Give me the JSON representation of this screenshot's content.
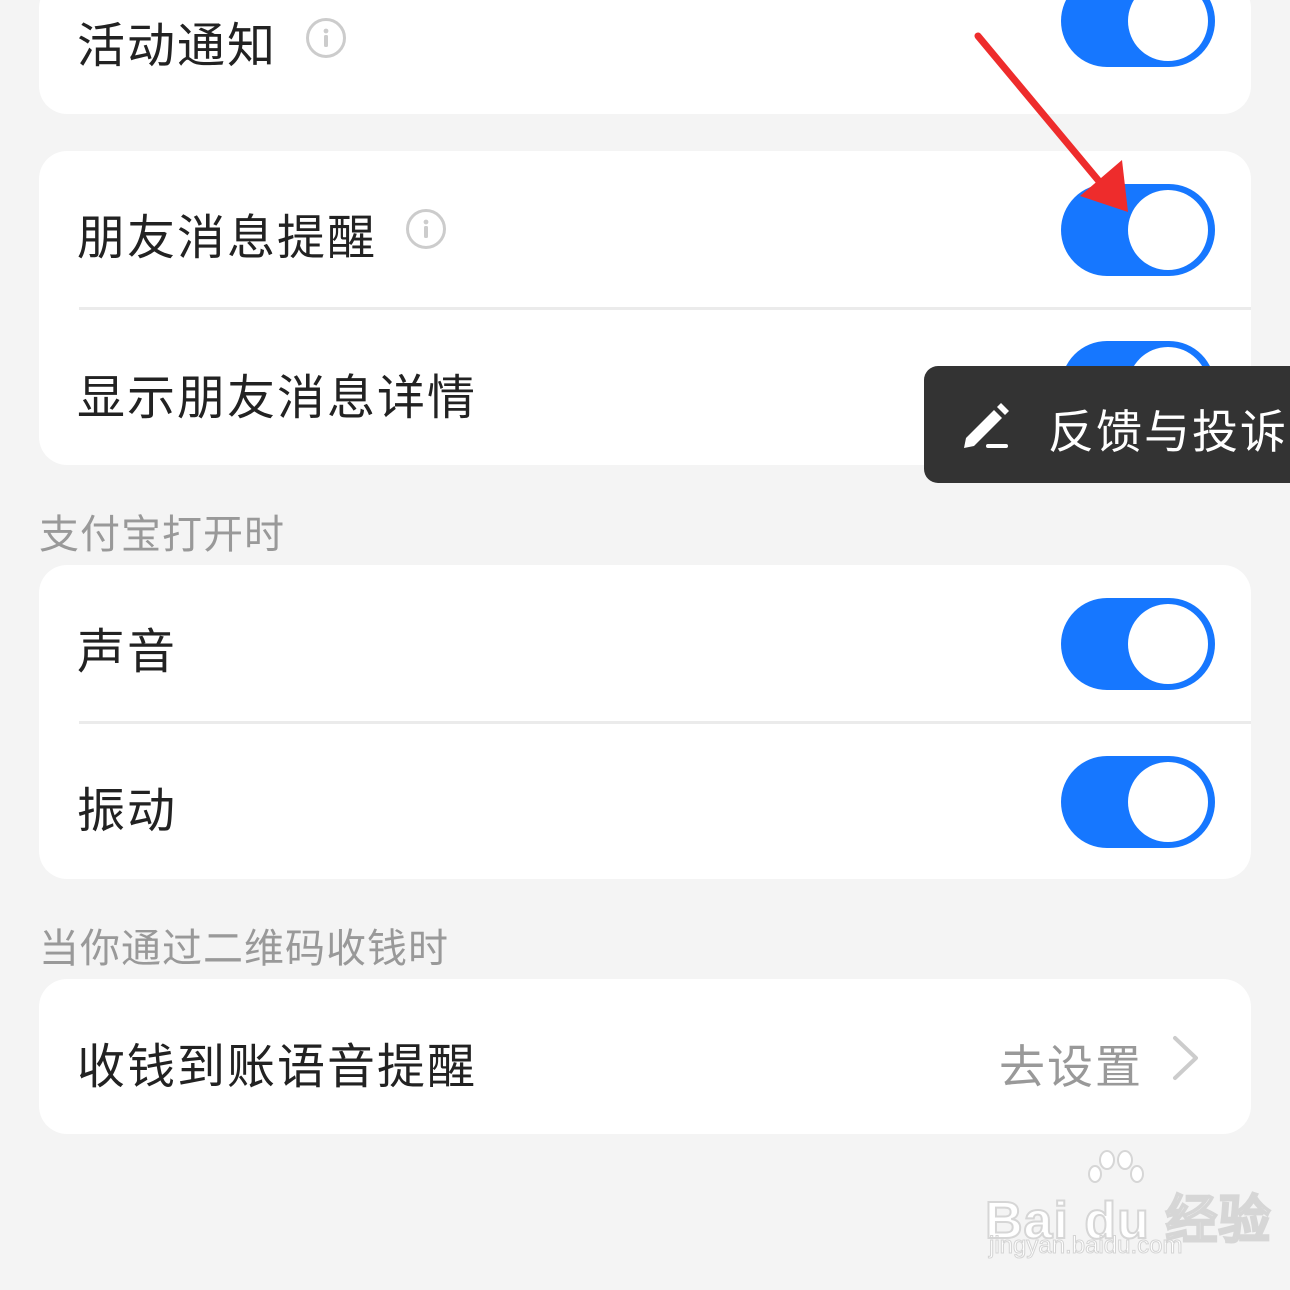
{
  "colors": {
    "accent": "#1677ff",
    "background": "#f4f4f4",
    "card": "#ffffff",
    "annotation_arrow": "#ee2c2c",
    "feedback_bg": "#333333"
  },
  "group1": {
    "items": [
      {
        "label": "活动通知",
        "has_info": true,
        "toggle_on": true
      }
    ]
  },
  "group2": {
    "items": [
      {
        "label": "朋友消息提醒",
        "has_info": true,
        "toggle_on": true
      },
      {
        "label": "显示朋友消息详情",
        "has_info": false,
        "toggle_on": true
      }
    ]
  },
  "section_open": {
    "title": "支付宝打开时",
    "items": [
      {
        "label": "声音",
        "toggle_on": true
      },
      {
        "label": "振动",
        "toggle_on": true
      }
    ]
  },
  "section_qr": {
    "title": "当你通过二维码收钱时",
    "items": [
      {
        "label": "收钱到账语音提醒",
        "action_label": "去设置",
        "icon": "chevron-right-icon"
      }
    ]
  },
  "feedback": {
    "label": "反馈与投诉",
    "icon": "pencil-icon"
  },
  "watermark": {
    "brand": "Bai du 经验",
    "url": "jingyan.baidu.com"
  }
}
